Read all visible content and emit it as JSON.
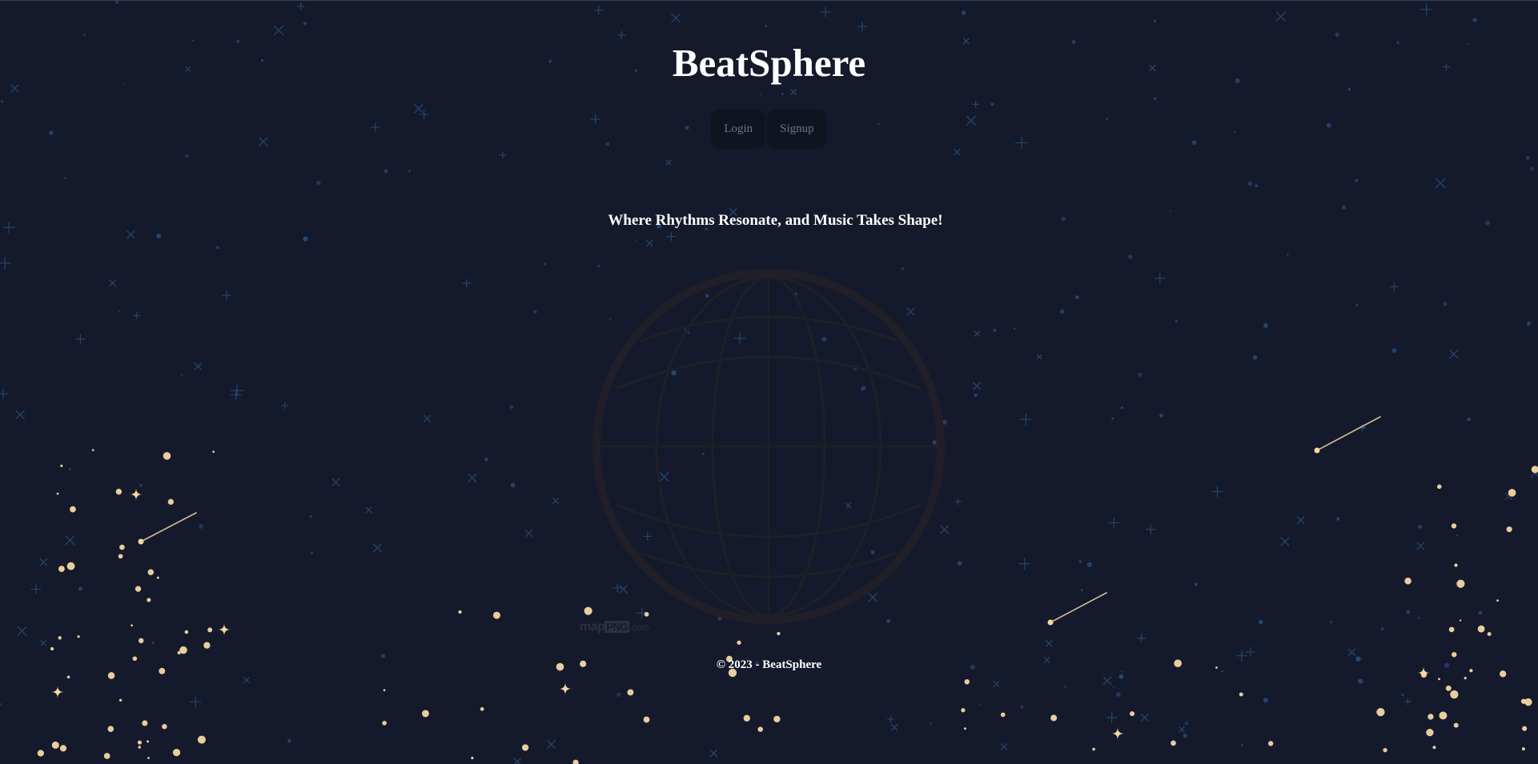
{
  "header": {
    "title": "BeatSphere"
  },
  "auth": {
    "login_label": "Login",
    "signup_label": "Signup"
  },
  "hero": {
    "tagline": "Where Rhythms Resonate, and Music Takes Shape!"
  },
  "watermark": {
    "prefix": "map",
    "middle": "PNG",
    "suffix": ".com"
  },
  "footer": {
    "copyright": "© 2023 - BeatSphere"
  },
  "icons": {
    "globe": "globe-icon"
  },
  "colors": {
    "background": "#141a2b",
    "star_blue": "#2a4a7a",
    "star_gold": "#f6d7a3",
    "button_bg": "#101420",
    "button_text": "#6d7286"
  }
}
